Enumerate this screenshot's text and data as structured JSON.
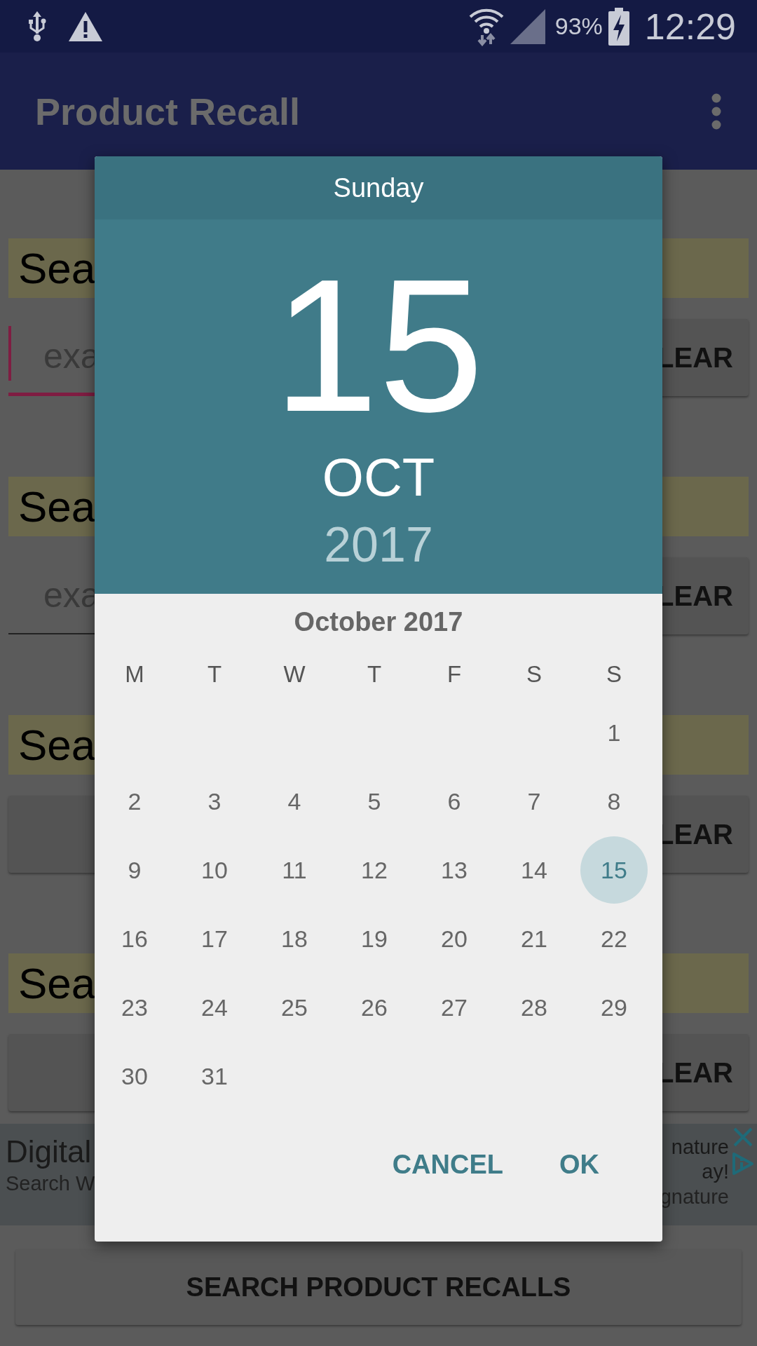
{
  "status_bar": {
    "battery": "93%",
    "time": "12:29"
  },
  "app_bar": {
    "title": "Product Recall"
  },
  "form_sections": [
    {
      "label": "Sea",
      "input": {
        "kind": "field",
        "placeholder": "exa",
        "focused": true
      },
      "clear_button": "LEAR"
    },
    {
      "label": "Sea",
      "input": {
        "kind": "field",
        "placeholder": "exa",
        "focused": false
      },
      "clear_button": "LEAR"
    },
    {
      "label": "Sea",
      "input": {
        "kind": "button"
      },
      "clear_button": "LEAR"
    },
    {
      "label": "Sea",
      "input": {
        "kind": "button"
      },
      "clear_button": "LEAR"
    }
  ],
  "ad": {
    "headline": "Digital",
    "subline": "Search W",
    "headline_right": "nature",
    "body_right": "ay!",
    "url_right": "gnature"
  },
  "search_button": "SEARCH PRODUCT RECALLS",
  "date_picker": {
    "weekday": "Sunday",
    "day": "15",
    "month": "OCT",
    "year": "2017",
    "month_title": "October 2017",
    "weekday_labels": [
      "M",
      "T",
      "W",
      "T",
      "F",
      "S",
      "S"
    ],
    "weeks": [
      [
        {
          "label": "1",
          "selected": false
        }
      ],
      [
        {
          "label": "2",
          "selected": false
        },
        {
          "label": "3",
          "selected": false
        },
        {
          "label": "4",
          "selected": false
        },
        {
          "label": "5",
          "selected": false
        },
        {
          "label": "6",
          "selected": false
        },
        {
          "label": "7",
          "selected": false
        },
        {
          "label": "8",
          "selected": false
        }
      ],
      [
        {
          "label": "9",
          "selected": false
        },
        {
          "label": "10",
          "selected": false
        },
        {
          "label": "11",
          "selected": false
        },
        {
          "label": "12",
          "selected": false
        },
        {
          "label": "13",
          "selected": false
        },
        {
          "label": "14",
          "selected": false
        },
        {
          "label": "15",
          "selected": true
        }
      ],
      [
        {
          "label": "16",
          "selected": false
        },
        {
          "label": "17",
          "selected": false
        },
        {
          "label": "18",
          "selected": false
        },
        {
          "label": "19",
          "selected": false
        },
        {
          "label": "20",
          "selected": false
        },
        {
          "label": "21",
          "selected": false
        },
        {
          "label": "22",
          "selected": false
        }
      ],
      [
        {
          "label": "23",
          "selected": false
        },
        {
          "label": "24",
          "selected": false
        },
        {
          "label": "25",
          "selected": false
        },
        {
          "label": "26",
          "selected": false
        },
        {
          "label": "27",
          "selected": false
        },
        {
          "label": "28",
          "selected": false
        },
        {
          "label": "29",
          "selected": false
        }
      ],
      [
        {
          "label": "30",
          "selected": false
        },
        {
          "label": "31",
          "selected": false
        }
      ]
    ],
    "buttons": [
      "CANCEL",
      "OK"
    ]
  }
}
